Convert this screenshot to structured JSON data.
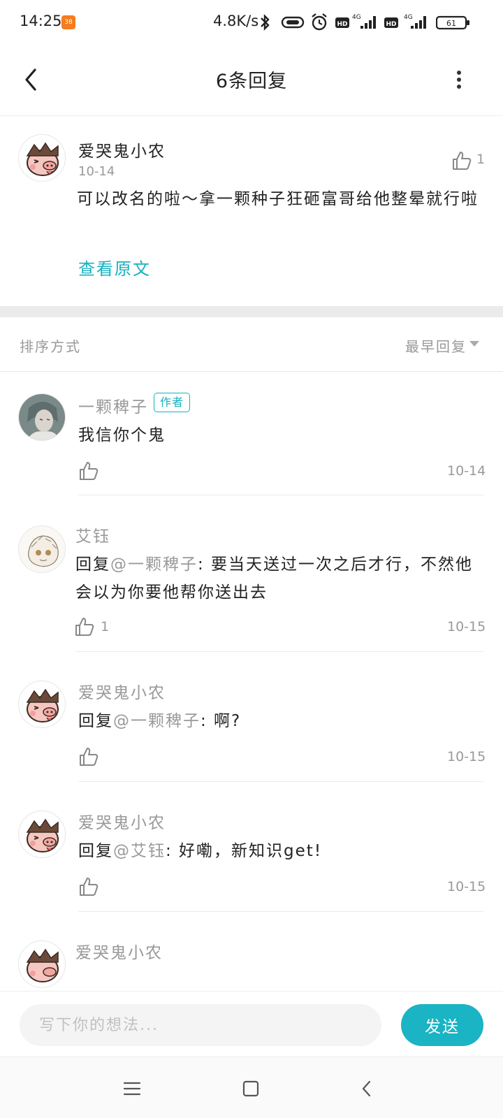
{
  "status_bar": {
    "time": "14:25",
    "app_badge": "38",
    "speed": "4.8K/s",
    "network_1": "4G",
    "network_2": "4G",
    "hd_1": "HD",
    "hd_2": "HD",
    "battery": "61"
  },
  "header": {
    "title": "6条回复"
  },
  "main_comment": {
    "author": "爱哭鬼小农",
    "date": "10-14",
    "text": "可以改名的啦～拿一颗种子狂砸富哥给他整晕就行啦",
    "like_count": "1",
    "view_original": "查看原文"
  },
  "sort": {
    "label": "排序方式",
    "value": "最早回复"
  },
  "replies": [
    {
      "author": "一颗稗子",
      "badge": "作者",
      "reply_prefix": "",
      "mention": "",
      "text": "我信你个鬼",
      "like_count": "",
      "date": "10-14"
    },
    {
      "author": "艾钰",
      "reply_prefix": "回复",
      "mention": "@一颗稗子",
      "text": ": 要当天送过一次之后才行，不然他会以为你要他帮你送出去",
      "like_count": "1",
      "date": "10-15"
    },
    {
      "author": "爱哭鬼小农",
      "reply_prefix": "回复",
      "mention": "@一颗稗子",
      "text": ": 啊?",
      "like_count": "",
      "date": "10-15"
    },
    {
      "author": "爱哭鬼小农",
      "reply_prefix": "回复",
      "mention": "@艾钰",
      "text": ": 好嘞，新知识get!",
      "like_count": "",
      "date": "10-15"
    },
    {
      "author": "爱哭鬼小农"
    }
  ],
  "input": {
    "placeholder": "写下你的想法...",
    "send_label": "发送"
  },
  "colors": {
    "accent": "#1ab4c4",
    "muted_text": "#999999",
    "primary_text": "#222222",
    "divider": "#ebebeb"
  },
  "icons": {
    "back": "chevron-left-icon",
    "more": "more-vertical-icon",
    "like": "thumbs-up-icon",
    "sort": "triangle-down-icon",
    "sys_menu": "menu-icon",
    "sys_home": "square-icon",
    "sys_back": "chevron-left-icon"
  }
}
